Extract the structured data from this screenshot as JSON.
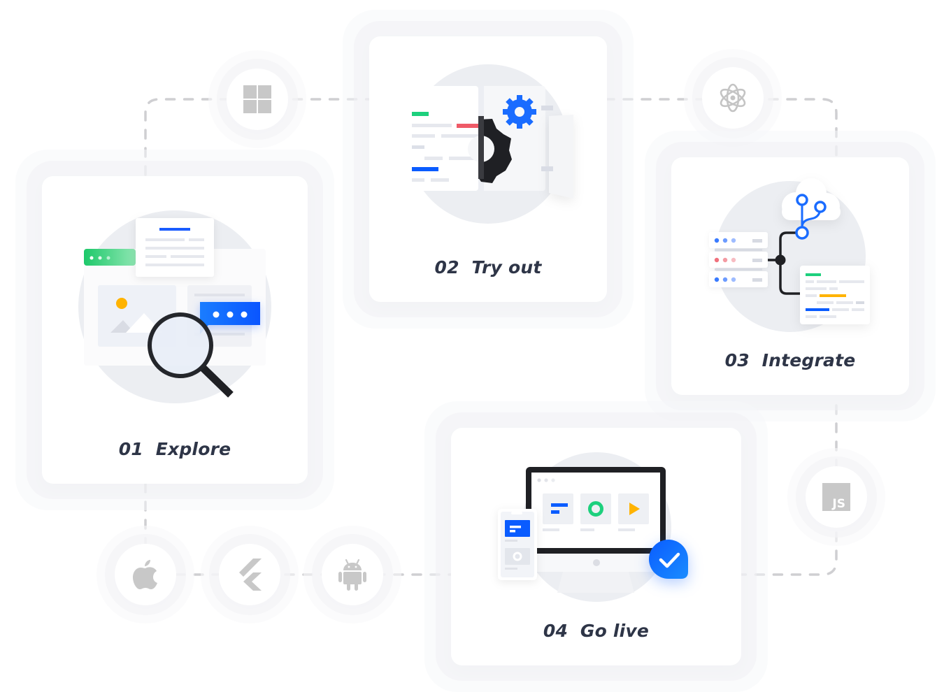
{
  "steps": [
    {
      "id": "explore",
      "number": "01",
      "title": "Explore",
      "label": "01  Explore"
    },
    {
      "id": "try-out",
      "number": "02",
      "title": "Try out",
      "label": "02  Try out"
    },
    {
      "id": "integrate",
      "number": "03",
      "title": "Integrate",
      "label": "03  Integrate"
    },
    {
      "id": "go-live",
      "number": "04",
      "title": "Go live",
      "label": "04  Go live"
    }
  ],
  "platforms": [
    {
      "id": "windows",
      "icon": "windows-icon"
    },
    {
      "id": "electron",
      "icon": "electron-icon"
    },
    {
      "id": "javascript",
      "icon": "javascript-icon",
      "text": "JS"
    },
    {
      "id": "apple",
      "icon": "apple-icon"
    },
    {
      "id": "flutter",
      "icon": "flutter-icon"
    },
    {
      "id": "android",
      "icon": "android-icon"
    }
  ],
  "colors": {
    "primary_blue": "#0a5cff",
    "green": "#1dd07d",
    "red": "#ef5a67",
    "amber": "#ffb300",
    "dark": "#1f2024",
    "icon_gray": "#c8c8c8",
    "dash_gray": "#cfcfd2",
    "text": "#2e3547"
  }
}
